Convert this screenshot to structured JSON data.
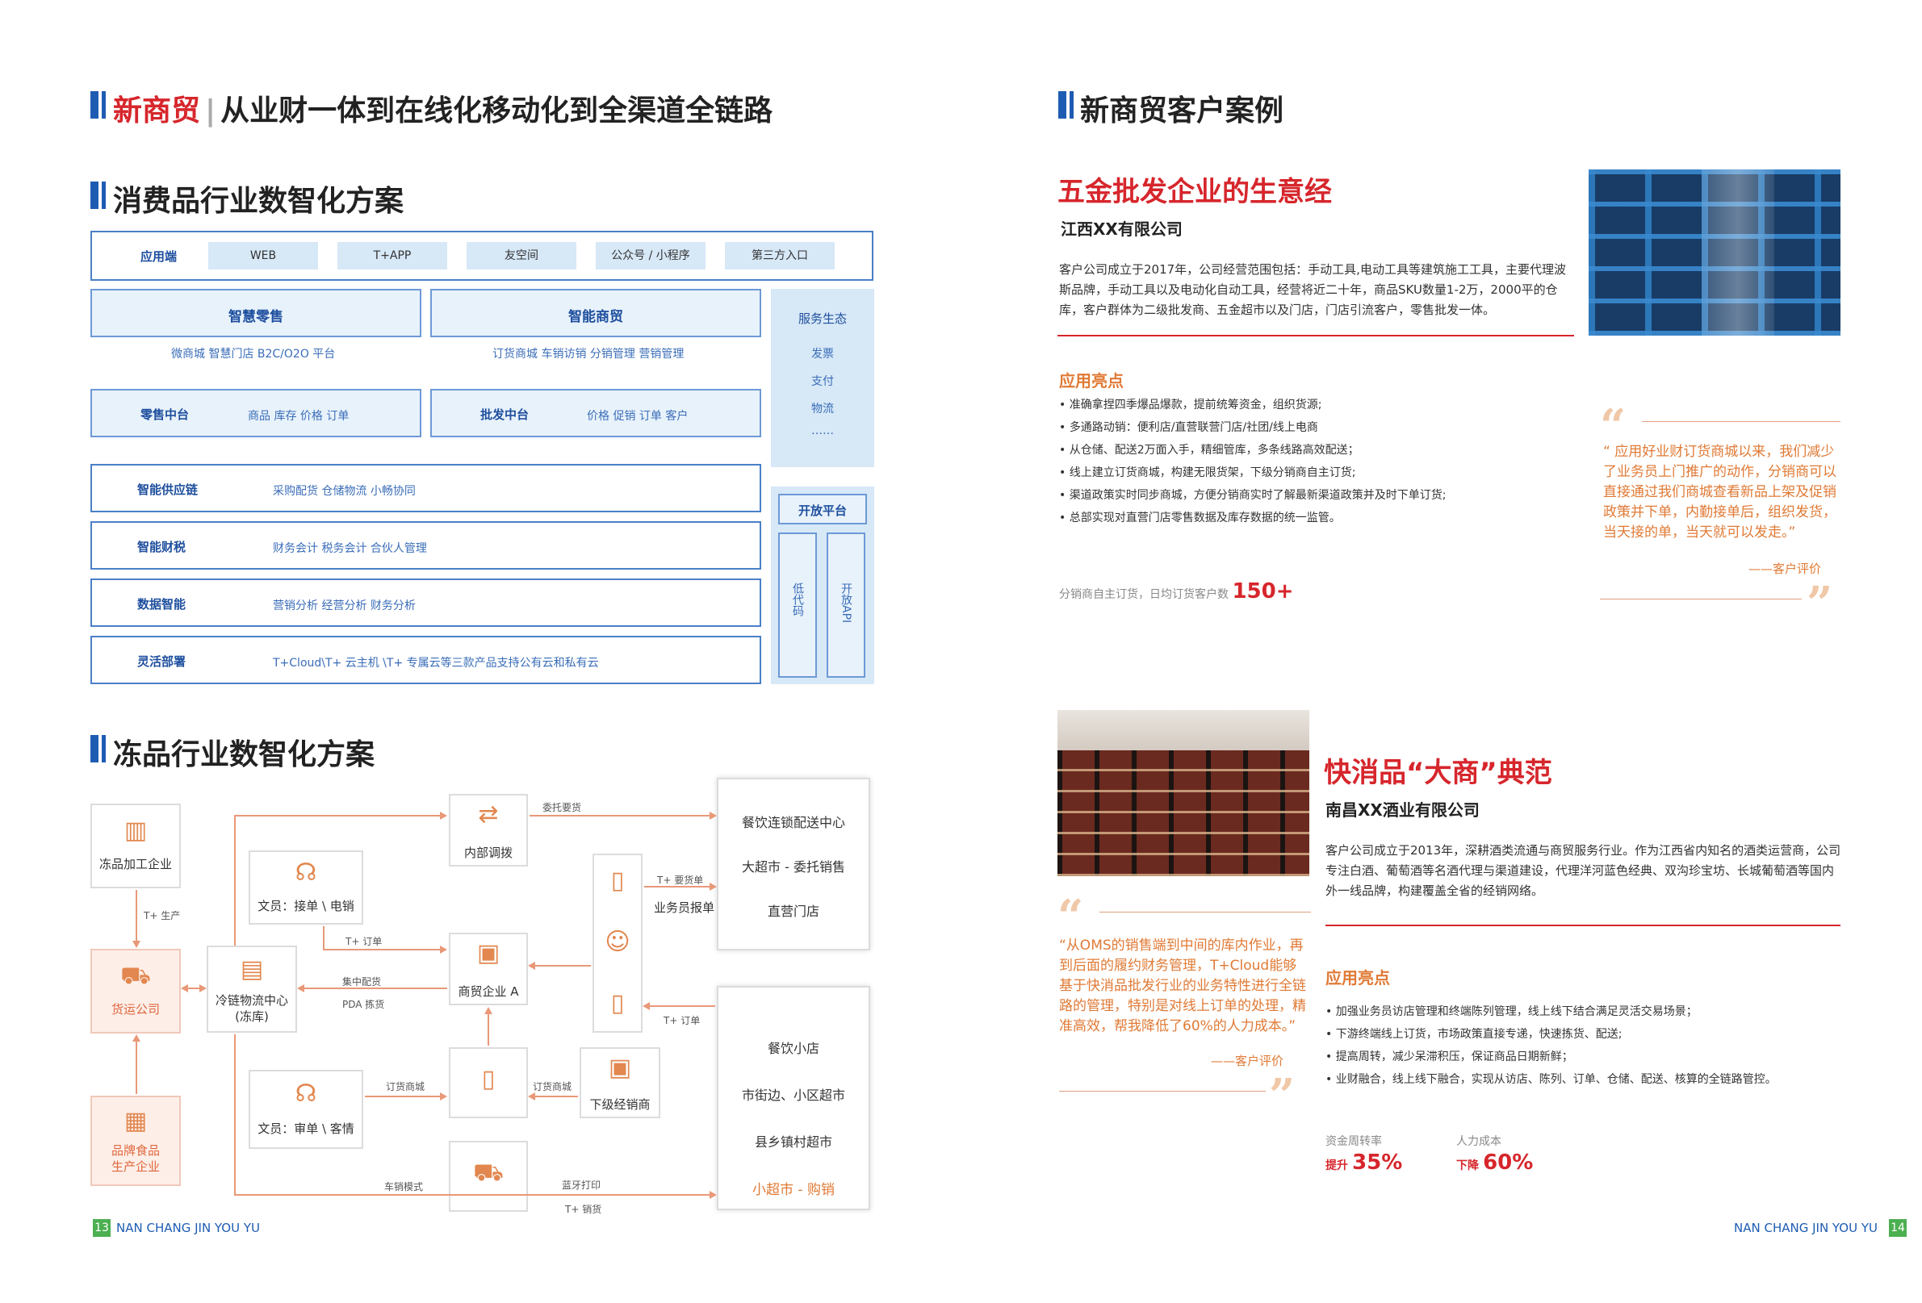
{
  "left": {
    "main_title_a": "新商贸",
    "main_title_sep": "|",
    "main_title_b": "从业财一体到在线化移动化到全渠道全链路",
    "section1_title": "消费品行业数智化方案",
    "app_row": {
      "label": "应用端",
      "chips": [
        "WEB",
        "T+APP",
        "友空间",
        "公众号 / 小程序",
        "第三方入口"
      ]
    },
    "retail": {
      "title": "智慧零售",
      "sub": "微商城   智慧门店   B2C/O2O 平台"
    },
    "trade": {
      "title": "智能商贸",
      "sub": "订货商城   车销访销   分销管理   营销管理"
    },
    "retail_mid": {
      "title": "零售中台",
      "items": "商品   库存   价格   订单"
    },
    "whole_mid": {
      "title": "批发中台",
      "items": "价格   促销   订单   客户"
    },
    "service": {
      "title": "服务生态",
      "items": [
        "发票",
        "支付",
        "物流",
        "……"
      ]
    },
    "open": {
      "title": "开放平台",
      "col1": "低代码",
      "col2": "开放API"
    },
    "rows": [
      {
        "title": "智能供应链",
        "items": "采购配货     仓储物流     小畅协同"
      },
      {
        "title": "智能财税",
        "items": "财务会计     税务会计     合伙人管理"
      },
      {
        "title": "数据智能",
        "items": "营销分析     经营分析     财务分析"
      },
      {
        "title": "灵活部署",
        "items": "T+Cloud\\T+ 云主机 \\T+ 专属云等三款产品支持公有云和私有云"
      }
    ],
    "section2_title": "冻品行业数智化方案",
    "flow": {
      "processor": "冻品加工企业",
      "freight": "货运公司",
      "brand": "品牌食品\n生产企业",
      "cold": "冷链物流中心\n(冻库)",
      "clerk1": "文员：接单 \\ 电销",
      "clerk2": "文员：审单 \\ 客情",
      "internal": "内部调拨",
      "trader": "商贸企业 A",
      "sub_dealer": "下级经销商",
      "salesman": "业务员报单",
      "right_top": [
        "餐饮连锁配送中心",
        "大超市 - 委托销售",
        "直营门店"
      ],
      "right_bottom": [
        "餐饮小店",
        "市街边、小区超市",
        "县乡镇村超市",
        "小超市 - 购销"
      ],
      "labels": {
        "t_prod": "T+ 生产",
        "entrust": "委托要货",
        "t_order": "T+ 订单",
        "t_order2": "T+ 订单",
        "t_need": "T+ 要货单",
        "pick": "集中配货",
        "pda": "PDA 拣货",
        "mall1": "订货商城",
        "mall2": "订货商城",
        "car": "车销模式",
        "bt": "蓝牙打印",
        "t_sale": "T+ 销货"
      }
    },
    "page_no": "13",
    "footer": "NAN CHANG JIN YOU YU"
  },
  "right": {
    "title": "新商贸客户案例",
    "case1": {
      "heading": "五金批发企业的生意经",
      "company": "江西XX有限公司",
      "desc": "客户公司成立于2017年，公司经营范围包括：手动工具,电动工具等建筑施工工具，主要代理波斯品牌，手动工具以及电动化自动工具，经营将近二十年，商品SKU数量1-2万，2000平的仓库，客户群体为二级批发商、五金超市以及门店，门店引流客户，零售批发一体。",
      "highlight_title": "应用亮点",
      "bullets": [
        "• 准确拿捏四季爆品爆款，提前统筹资金，组织货源;",
        "• 多通路动销：便利店/直营联营门店/社团/线上电商",
        "• 从仓储、配送2万面入手，精细管库，多条线路高效配送；",
        "• 线上建立订货商城，构建无限货架，下级分销商自主订货;",
        "• 渠道政策实时同步商城，方便分销商实时了解最新渠道政策并及时下单订货;",
        "• 总部实现对直营门店零售数据及库存数据的统一监管。"
      ],
      "stat_label": "分销商自主订货，日均订货客户数",
      "stat_value": "150+",
      "quote": "“    应用好业财订货商城以来，我们减少了业务员上门推广的动作，分销商可以直接通过我们商城查看新品上架及促销政策并下单，内勤接单后，组织发货，当天接的单，当天就可以发走。”",
      "quote_by": "——客户评价"
    },
    "case2": {
      "heading": "快消品“大商”典范",
      "company": "南昌XX酒业有限公司",
      "desc": "客户公司成立于2013年，深耕酒类流通与商贸服务行业。作为江西省内知名的酒类运营商，公司专注白酒、葡萄酒等名酒代理与渠道建设，代理洋河蓝色经典、双沟珍宝坊、长城葡萄酒等国内外一线品牌，构建覆盖全省的经销网络。",
      "quote": "“从OMS的销售端到中间的库内作业，再到后面的履约财务管理，T+Cloud能够基于快消品批发行业的业务特性进行全链路的管理，特别是对线上订单的处理，精准高效，帮我降低了60%的人力成本。”",
      "quote_by": "——客户评价",
      "highlight_title": "应用亮点",
      "bullets": [
        "• 加强业务员访店管理和终端陈列管理，线上线下结合满足灵活交易场景；",
        "• 下游终端线上订货，市场政策直接专递，快速拣货、配送;",
        "• 提高周转，减少呆滞积压，保证商品日期新鲜；",
        "• 业财融合，线上线下融合，实现从访店、陈列、订单、仓储、配送、核算的全链路管控。"
      ],
      "stat1_label": "资金周转率",
      "stat1_prefix": "提升",
      "stat1_value": "35%",
      "stat2_label": "人力成本",
      "stat2_prefix": "下降",
      "stat2_value": "60%"
    },
    "footer": "NAN CHANG JIN YOU YU",
    "page_no": "14"
  },
  "colors": {
    "brand_blue": "#1e5cb3",
    "red": "#d6262c",
    "orange": "#e07a35",
    "green": "#4caf50"
  }
}
